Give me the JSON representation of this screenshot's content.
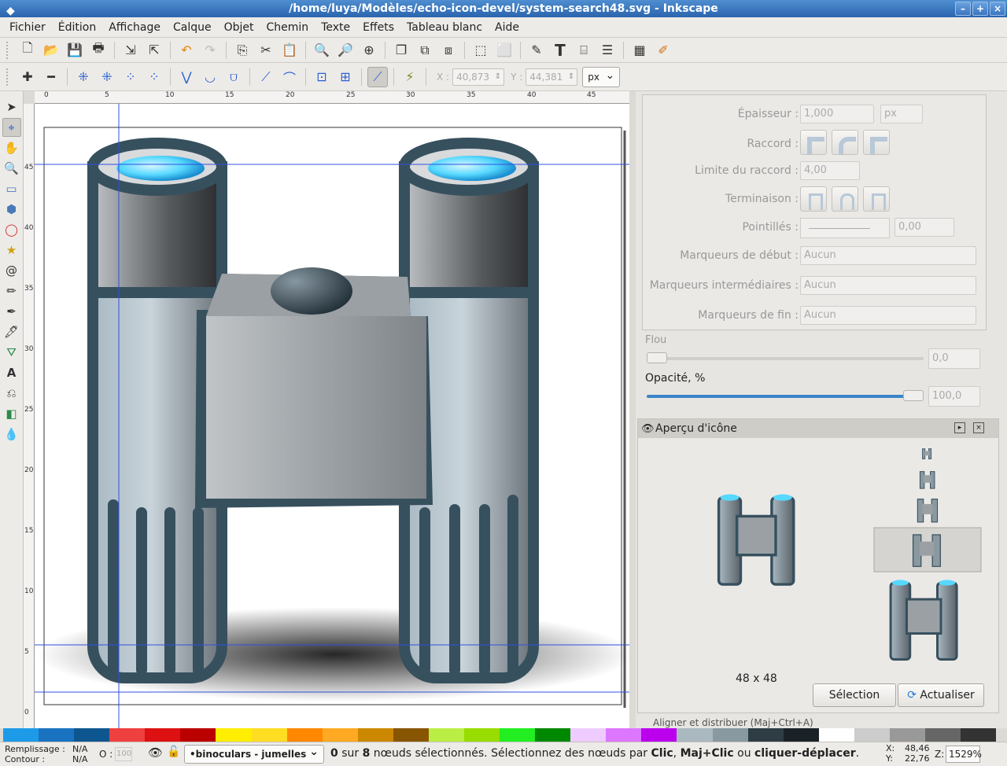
{
  "window": {
    "title": "/home/luya/Modèles/echo-icon-devel/system-search48.svg - Inkscape",
    "buttons": [
      "–",
      "+",
      "×"
    ]
  },
  "menu": [
    "Fichier",
    "Édition",
    "Affichage",
    "Calque",
    "Objet",
    "Chemin",
    "Texte",
    "Effets",
    "Tableau blanc",
    "Aide"
  ],
  "controls": {
    "x_label": "X :",
    "x_value": "40,873",
    "y_label": "Y :",
    "y_value": "44,381",
    "unit": "px"
  },
  "ruler_top": [
    "0",
    "5",
    "10",
    "15",
    "20",
    "25",
    "30",
    "35",
    "40",
    "45"
  ],
  "ruler_left": [
    "45",
    "40",
    "35",
    "30",
    "25",
    "20",
    "15",
    "10",
    "5",
    "0"
  ],
  "stroke": {
    "width_label": "Épaisseur :",
    "width_value": "1,000",
    "width_unit": "px",
    "join_label": "Raccord :",
    "miter_label": "Limite du raccord :",
    "miter_value": "4,00",
    "cap_label": "Terminaison :",
    "dash_label": "Pointillés :",
    "dash_value": "0,00",
    "start_marker_label": "Marqueurs de début :",
    "mid_marker_label": "Marqueurs intermédiaires :",
    "end_marker_label": "Marqueurs de fin :",
    "marker_value": "Aucun"
  },
  "blur": {
    "label": "Flou",
    "value": "0,0",
    "level_percent": 0
  },
  "opacity": {
    "label": "Opacité, %",
    "value": "100,0",
    "level_percent": 100
  },
  "icon_preview": {
    "title": "Aperçu d'icône",
    "size_label": "48 x 48",
    "selection_button": "Sélection",
    "refresh_button": "Actualiser"
  },
  "align_panel_peek": "Aligner et distribuer (Maj+Ctrl+A)",
  "palette": [
    "#1e9be8",
    "#1a73c0",
    "#0e5690",
    "#ef4040",
    "#dd1111",
    "#bb0000",
    "#ffee00",
    "#ffdd22",
    "#ff8800",
    "#ffaa22",
    "#cc8800",
    "#885500",
    "#bbee44",
    "#99dd00",
    "#22ee22",
    "#008800",
    "#eeccff",
    "#dd77ff",
    "#bb00ee",
    "#aab8c0",
    "#8899a0",
    "#2e3c44",
    "#1a2228",
    "#ffffff",
    "#cccccc",
    "#999999",
    "#666666",
    "#333333"
  ],
  "status": {
    "fill_label": "Remplissage :",
    "fill_value": "N/A",
    "stroke_label": "Contour :",
    "stroke_value": "N/A",
    "opacity_label": "O :",
    "opacity_value": "100",
    "layer": "•binoculars - jumelles",
    "msg_count": "0",
    "msg_sur": " sur ",
    "msg_total": "8",
    "msg_rest": " nœuds sélectionnés. Sélectionnez des nœuds par ",
    "msg_k1": "Clic",
    "msg_comma": ", ",
    "msg_k2": "Maj+Clic",
    "msg_ou": " ou ",
    "msg_k3": "cliquer-déplacer",
    "msg_end": ".",
    "x_label": "X:",
    "x_value": "48,46",
    "y_label": "Y:",
    "y_value": "22,76",
    "zoom_label": "Z:",
    "zoom_value": "1529%"
  }
}
